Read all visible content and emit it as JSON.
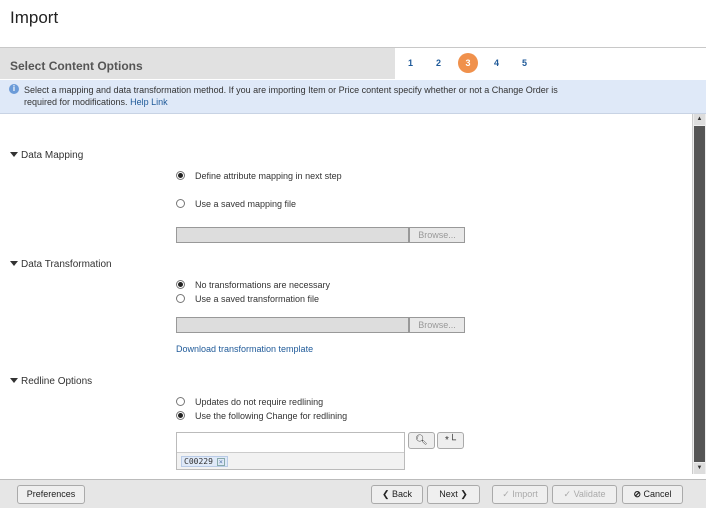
{
  "title": "Import",
  "header": {
    "title": "Select Content Options",
    "steps": [
      "1",
      "2",
      "3",
      "4",
      "5"
    ],
    "current_step": 3
  },
  "info": {
    "text": "Select a mapping and data transformation method. If you are importing Item or Price content specify whether or not a Change Order is required for modifications.",
    "help_link": "Help Link"
  },
  "data_mapping": {
    "label": "Data Mapping",
    "options": [
      "Define attribute mapping in next step",
      "Use a saved mapping file"
    ],
    "selected": 0,
    "browse": "Browse...",
    "file_value": ""
  },
  "data_transformation": {
    "label": "Data Transformation",
    "options": [
      "No transformations are necessary",
      "Use a saved transformation file"
    ],
    "selected": 0,
    "browse": "Browse...",
    "file_value": "",
    "download_link": "Download transformation template"
  },
  "redline": {
    "label": "Redline Options",
    "options": [
      "Updates do not require redlining",
      "Use the following Change for redlining"
    ],
    "selected": 1,
    "change_token": "C00229",
    "input_value": ""
  },
  "footer": {
    "preferences": "Preferences",
    "back": "Back",
    "next": "Next",
    "import": "Import",
    "validate": "Validate",
    "cancel": "Cancel"
  }
}
